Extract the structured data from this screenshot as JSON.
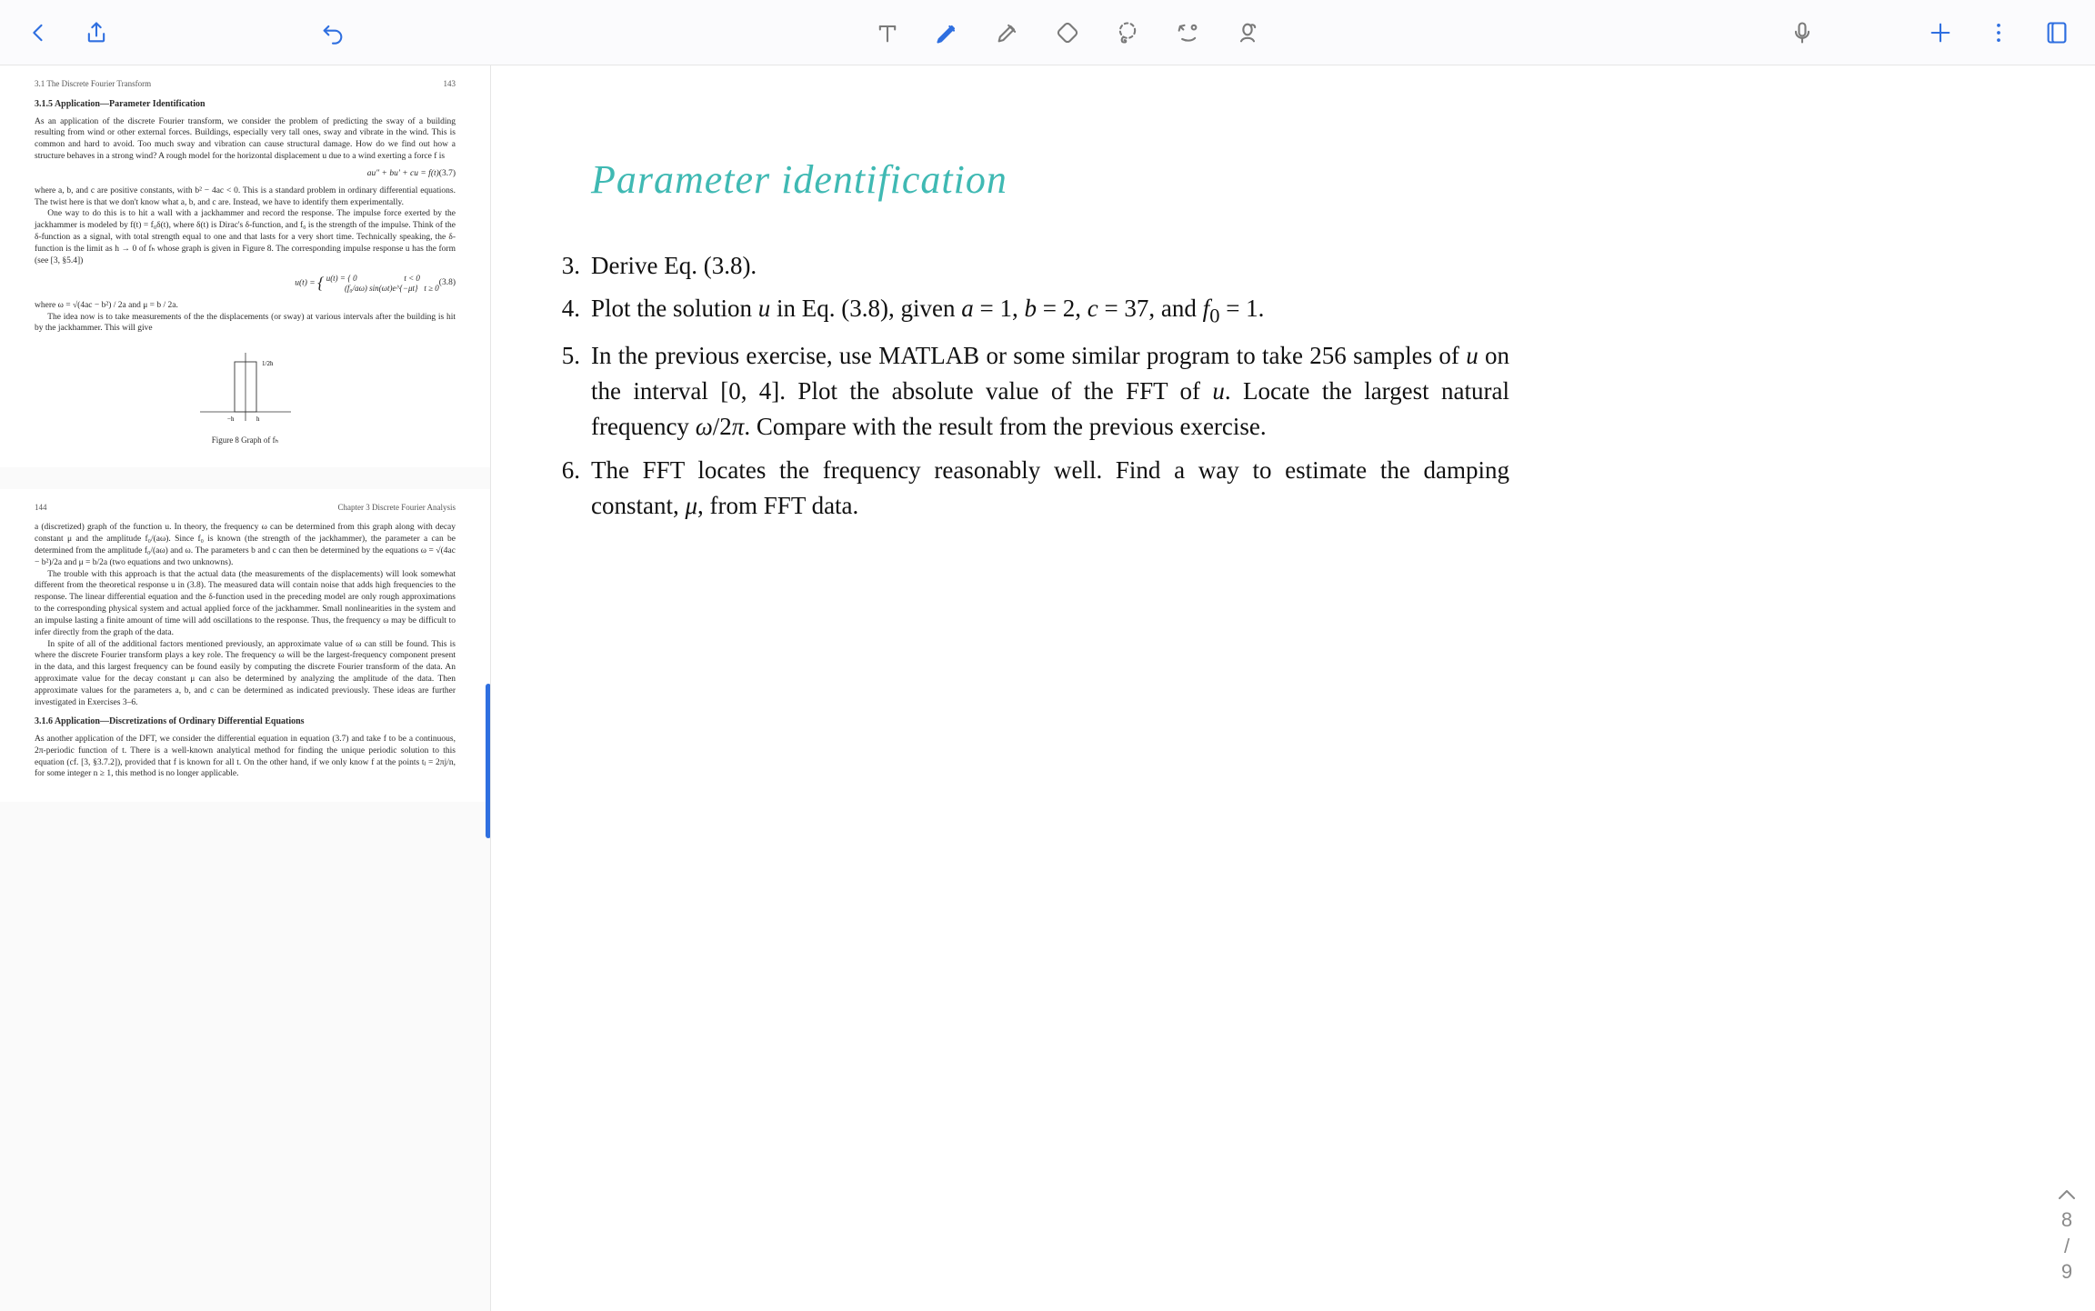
{
  "toolbar": {
    "back_icon": "back",
    "share_icon": "share",
    "undo_icon": "undo",
    "text_tool": "text",
    "pen_tool": "pen",
    "highlighter_tool": "highlighter",
    "eraser_tool": "eraser",
    "lasso_tool": "lasso",
    "shape_tool": "shape",
    "stamp_tool": "stamp",
    "mic_icon": "microphone",
    "add_icon": "add",
    "more_icon": "more",
    "pages_icon": "pages"
  },
  "handwriting": {
    "title": "Parameter identification",
    "color": "#3fb9b3"
  },
  "problems": [
    {
      "n": "3.",
      "text": "Derive Eq. (3.8)."
    },
    {
      "n": "4.",
      "text": "Plot the solution u in Eq. (3.8), given a = 1, b = 2, c = 37, and f₀ = 1."
    },
    {
      "n": "5.",
      "text": "In the previous exercise, use MATLAB or some similar program to take 256 samples of u on the interval [0, 4]. Plot the absolute value of the FFT of u. Locate the largest natural frequency ω/2π. Compare with the result from the previous exercise."
    },
    {
      "n": "6.",
      "text": "The FFT locates the frequency reasonably well. Find a way to estimate the damping constant, μ, from FFT data."
    }
  ],
  "page_nav": {
    "current": "8",
    "sep": "/",
    "total": "9"
  },
  "thumbs": {
    "page1": {
      "running_head": "3.1 The Discrete Fourier Transform",
      "page_num": "143",
      "section": "3.1.5   Application—Parameter Identification",
      "para1": "As an application of the discrete Fourier transform, we consider the problem of predicting the sway of a building resulting from wind or other external forces. Buildings, especially very tall ones, sway and vibrate in the wind. This is common and hard to avoid. Too much sway and vibration can cause structural damage. How do we find out how a structure behaves in a strong wind? A rough model for the horizontal displacement u due to a wind exerting a force f is",
      "eq37": "au″ + bu′ + cu = f(t)",
      "eq37num": "(3.7)",
      "para2": "where a, b, and c are positive constants, with b² − 4ac < 0. This is a standard problem in ordinary differential equations. The twist here is that we don't know what a, b, and c are. Instead, we have to identify them experimentally.",
      "para3": "One way to do this is to hit a wall with a jackhammer and record the response. The impulse force exerted by the jackhammer is modeled by f(t) = f₀δ(t), where δ(t) is Dirac's δ-function, and f₀ is the strength of the impulse. Think of the δ-function as a signal, with total strength equal to one and that lasts for a very short time. Technically speaking, the δ-function is the limit as h → 0 of fₕ whose graph is given in Figure 8. The corresponding impulse response u has the form (see [3, §5.4])",
      "eq38a": "u(t) = { 0                       t < 0",
      "eq38b": "         (f₀/aω) sin(ωt)e^{−μt}   t ≥ 0",
      "eq38num": "(3.8)",
      "para4_pre": "where ω = ",
      "para4_frac1": "√(4ac − b²) / 2a",
      "para4_mid": " and μ = ",
      "para4_frac2": "b / 2a",
      "para4_post": ".",
      "para5": "The idea now is to take measurements of the the displacements (or sway) at various intervals after the building is hit by the jackhammer. This will give",
      "fig_caption": "Figure 8  Graph of fₕ",
      "graph_label_top": "1/2h",
      "graph_label_left": "−h",
      "graph_label_right": "h"
    },
    "page2": {
      "page_num": "144",
      "running_head": "Chapter 3  Discrete Fourier Analysis",
      "para1": "a (discretized) graph of the function u. In theory, the frequency ω can be determined from this graph along with decay constant μ and the amplitude f₀/(aω). Since f₀ is known (the strength of the jackhammer), the parameter a can be determined from the amplitude f₀/(aω) and ω. The parameters b and c can then be determined by the equations ω = √(4ac − b²)/2a and μ = b/2a (two equations and two unknowns).",
      "para2": "The trouble with this approach is that the actual data (the measurements of the displacements) will look somewhat different from the theoretical response u in (3.8). The measured data will contain noise that adds high frequencies to the response. The linear differential equation and the δ-function used in the preceding model are only rough approximations to the corresponding physical system and actual applied force of the jackhammer. Small nonlinearities in the system and an impulse lasting a finite amount of time will add oscillations to the response. Thus, the frequency ω may be difficult to infer directly from the graph of the data.",
      "para3": "In spite of all of the additional factors mentioned previously, an approximate value of ω can still be found. This is where the discrete Fourier transform plays a key role. The frequency ω will be the largest-frequency component present in the data, and this largest frequency can be found easily by computing the discrete Fourier transform of the data. An approximate value for the decay constant μ can also be determined by analyzing the amplitude of the data. Then approximate values for the parameters a, b, and c can be determined as indicated previously. These ideas are further investigated in Exercises 3–6.",
      "section2": "3.1.6   Application—Discretizations of Ordinary Differential Equations",
      "para4": "As another application of the DFT, we consider the differential equation in equation (3.7) and take f to be a continuous, 2π-periodic function of t. There is a well-known analytical method for finding the unique periodic solution to this equation (cf. [3, §3.7.2]), provided that f is known for all t. On the other hand, if we only know f at the points tⱼ = 2πj/n, for some integer n ≥ 1, this method is no longer applicable."
    }
  }
}
